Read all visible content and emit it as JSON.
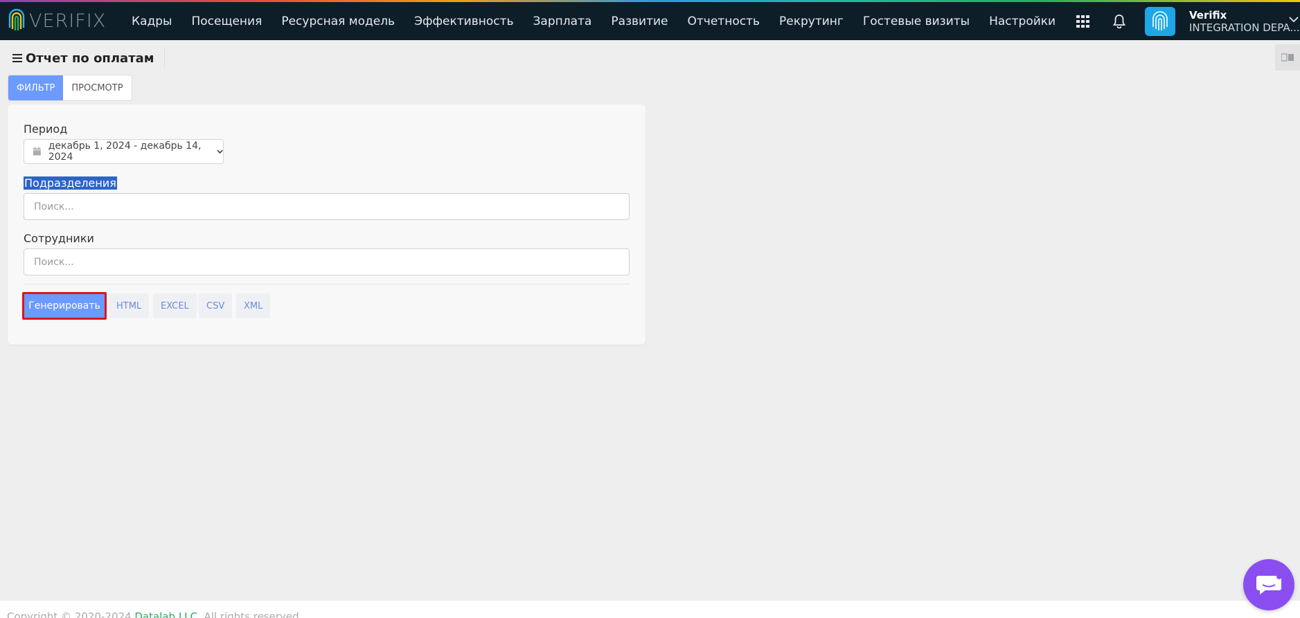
{
  "brand": {
    "logo_text": "VERIFIX"
  },
  "nav": {
    "items": [
      "Кадры",
      "Посещения",
      "Ресурсная модель",
      "Эффективность",
      "Зарплата",
      "Развитие",
      "Отчетность",
      "Рекрутинг",
      "Гостевые визиты",
      "Настройки"
    ]
  },
  "user": {
    "name": "Verifix",
    "dept": "INTEGRATION DEPA..."
  },
  "page": {
    "title": "Отчет по оплатам"
  },
  "tabs": {
    "filter": "ФИЛЬТР",
    "view": "ПРОСМОТР"
  },
  "form": {
    "period_label": "Период",
    "period_value": "декабрь 1, 2024 - декабрь 14, 2024",
    "dept_label": "Подразделения",
    "dept_placeholder": "Поиск...",
    "emp_label": "Сотрудники",
    "emp_placeholder": "Поиск..."
  },
  "actions": {
    "generate": "Генерировать",
    "html": "HTML",
    "excel": "EXCEL",
    "csv": "CSV",
    "xml": "XML"
  },
  "footer": {
    "prefix": "Copyright © 2020-2024 ",
    "company": "Datalab LLC",
    "suffix": ". All rights reserved."
  },
  "colors": {
    "navbar": "#0e1e29",
    "accent": "#6b9bff",
    "highlight": "#e0131d",
    "chat": "#8a4ef0"
  },
  "icons": [
    "fingerprint-logo-icon",
    "apps-grid-icon",
    "bell-icon",
    "fingerprint-avatar-icon",
    "chevron-down-icon",
    "hamburger-icon",
    "calendar-icon",
    "translate-icon",
    "chat-icon"
  ]
}
